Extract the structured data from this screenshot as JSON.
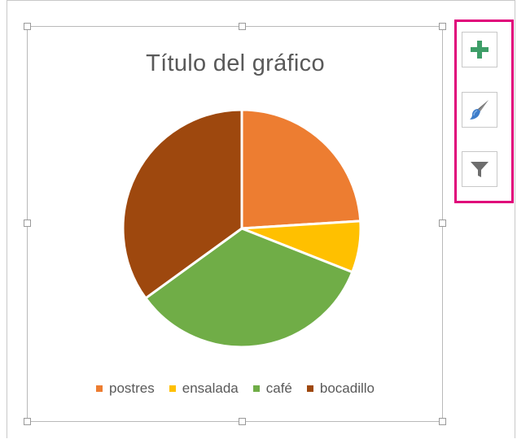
{
  "chart": {
    "title": "Título del gráfico",
    "legend": [
      "postres",
      "ensalada",
      "café",
      "bocadillo"
    ]
  },
  "chart_data": {
    "type": "pie",
    "title": "Título del gráfico",
    "categories": [
      "postres",
      "ensalada",
      "café",
      "bocadillo"
    ],
    "values": [
      24,
      7,
      34,
      35
    ],
    "colors": [
      "#ed7d31",
      "#ffc000",
      "#70ad47",
      "#9e480e"
    ],
    "legend_position": "bottom"
  },
  "toolbar": {
    "buttons": [
      {
        "name": "chart-elements-button",
        "icon": "plus-icon"
      },
      {
        "name": "chart-styles-button",
        "icon": "paintbrush-icon"
      },
      {
        "name": "chart-filters-button",
        "icon": "funnel-icon"
      }
    ],
    "highlight_color": "#e0007a"
  }
}
